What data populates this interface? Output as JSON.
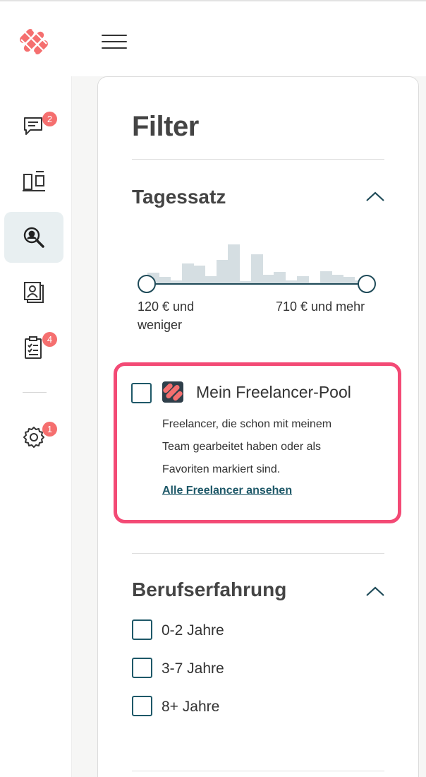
{
  "header": {
    "menu_icon": "hamburger-menu-icon",
    "logo_icon": "brand-logo-icon"
  },
  "colors": {
    "brand": "#f56f6f",
    "accent": "#1e4a58",
    "highlight": "#f34a75",
    "histogram": "#d5dee2"
  },
  "sidebar": {
    "items": [
      {
        "icon": "chat-icon",
        "badge": "2"
      },
      {
        "icon": "dashboard-icon",
        "badge": ""
      },
      {
        "icon": "search-icon",
        "badge": "",
        "active": true
      },
      {
        "icon": "contacts-icon",
        "badge": ""
      },
      {
        "icon": "clipboard-icon",
        "badge": "4"
      },
      {
        "icon": "settings-icon",
        "badge": "1"
      }
    ]
  },
  "filter": {
    "title": "Filter",
    "rate": {
      "title": "Tagessatz",
      "min_label_1": "120 € und",
      "min_label_2": "weniger",
      "max_label": "710 € und mehr",
      "histogram": [
        0.28,
        0.18,
        0.1,
        0.5,
        0.45,
        0.2,
        0.58,
        0.95,
        0.08,
        0.72,
        0.24,
        0.3,
        0.1,
        0.2,
        0.05,
        0.32,
        0.24,
        0.18,
        0.1
      ]
    },
    "pool": {
      "title": "Mein Freelancer-Pool",
      "desc_1": "Freelancer, die schon mit meinem",
      "desc_2": "Team gearbeitet haben oder als",
      "desc_3": "Favoriten markiert sind.",
      "link": "Alle Freelancer ansehen"
    },
    "experience": {
      "title": "Berufserfahrung",
      "options": [
        "0-2 Jahre",
        "3-7 Jahre",
        "8+ Jahre"
      ]
    }
  }
}
